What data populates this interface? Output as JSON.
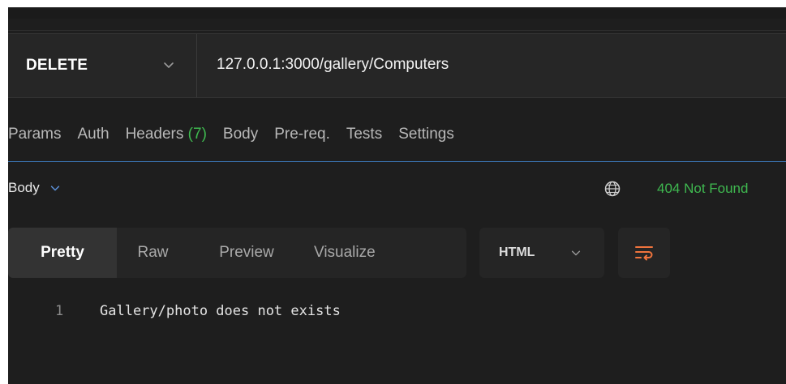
{
  "request": {
    "method": "DELETE",
    "url": "127.0.0.1:3000/gallery/Computers"
  },
  "request_tabs": [
    {
      "label": "Params"
    },
    {
      "label": "Auth"
    },
    {
      "label": "Headers",
      "count": "(7)"
    },
    {
      "label": "Body"
    },
    {
      "label": "Pre-req."
    },
    {
      "label": "Tests"
    },
    {
      "label": "Settings"
    }
  ],
  "response": {
    "section_label": "Body",
    "status": "404 Not Found",
    "view_modes": [
      "Pretty",
      "Raw",
      "Preview",
      "Visualize"
    ],
    "active_view_mode": "Pretty",
    "language": "HTML",
    "lines": [
      {
        "number": "1",
        "text": "Gallery/photo does not exists"
      }
    ]
  },
  "icons": {
    "method_chevron": "chevron-down-icon",
    "body_chevron": "chevron-down-icon",
    "globe": "globe-icon",
    "language_chevron": "chevron-down-icon",
    "wrap": "wrap-lines-icon"
  },
  "colors": {
    "background": "#1e1e1e",
    "panel": "#252525",
    "success_green": "#3fb950",
    "wrap_icon_orange": "#f0743d",
    "tab_underline_blue": "#3b76b6"
  }
}
